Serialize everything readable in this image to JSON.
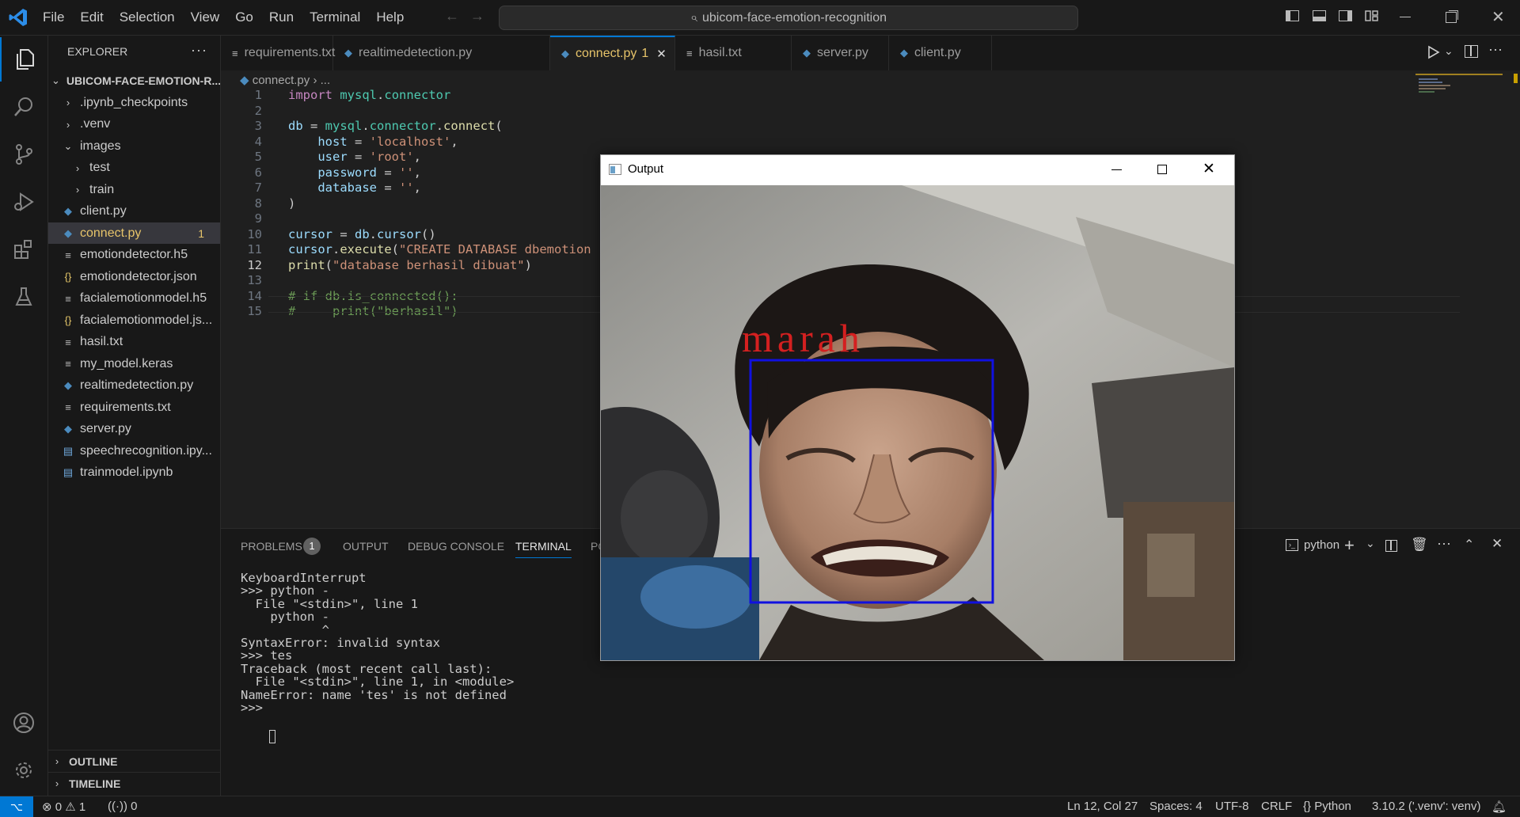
{
  "titlebar": {
    "menu": [
      "File",
      "Edit",
      "Selection",
      "View",
      "Go",
      "Run",
      "Terminal",
      "Help"
    ],
    "search": "ubicom-face-emotion-recognition"
  },
  "sidebar": {
    "header": "EXPLORER",
    "project": "UBICOM-FACE-EMOTION-R...",
    "items": [
      {
        "label": ".ipynb_checkpoints",
        "icon": "chevron-right-icon"
      },
      {
        "label": ".venv",
        "icon": "chevron-right-icon"
      },
      {
        "label": "images",
        "icon": "chevron-down-icon"
      },
      {
        "label": "test",
        "icon": "chevron-right-icon"
      },
      {
        "label": "train",
        "icon": "chevron-right-icon"
      },
      {
        "label": "client.py",
        "icon": "python-icon"
      },
      {
        "label": "connect.py",
        "icon": "python-icon",
        "badge": "1"
      },
      {
        "label": "emotiondetector.h5",
        "icon": "file-lines-icon"
      },
      {
        "label": "emotiondetector.json",
        "icon": "json-icon"
      },
      {
        "label": "facialemotionmodel.h5",
        "icon": "file-lines-icon"
      },
      {
        "label": "facialemotionmodel.js...",
        "icon": "json-icon"
      },
      {
        "label": "hasil.txt",
        "icon": "file-lines-icon"
      },
      {
        "label": "my_model.keras",
        "icon": "file-lines-icon"
      },
      {
        "label": "realtimedetection.py",
        "icon": "python-icon"
      },
      {
        "label": "requirements.txt",
        "icon": "file-lines-icon"
      },
      {
        "label": "server.py",
        "icon": "python-icon"
      },
      {
        "label": "speechrecognition.ipy...",
        "icon": "notebook-icon"
      },
      {
        "label": "trainmodel.ipynb",
        "icon": "notebook-icon"
      }
    ],
    "outline": "OUTLINE",
    "timeline": "TIMELINE"
  },
  "tabs": [
    {
      "label": "requirements.txt",
      "icon": "file-lines-icon"
    },
    {
      "label": "realtimedetection.py",
      "icon": "python-icon"
    },
    {
      "label": "connect.py",
      "icon": "python-icon",
      "badge": "1",
      "active": true
    },
    {
      "label": "hasil.txt",
      "icon": "file-lines-icon"
    },
    {
      "label": "server.py",
      "icon": "python-icon"
    },
    {
      "label": "client.py",
      "icon": "python-icon"
    }
  ],
  "breadcrumb": {
    "file": "connect.py",
    "rest": "..."
  },
  "editor": {
    "lines": [
      {
        "n": "1",
        "code": "import mysql.connector"
      },
      {
        "n": "2",
        "code": ""
      },
      {
        "n": "3",
        "code": "db = mysql.connector.connect("
      },
      {
        "n": "4",
        "code": "    host = 'localhost',"
      },
      {
        "n": "5",
        "code": "    user = 'root',"
      },
      {
        "n": "6",
        "code": "    password = '',"
      },
      {
        "n": "7",
        "code": "    database = '',"
      },
      {
        "n": "8",
        "code": ")"
      },
      {
        "n": "9",
        "code": ""
      },
      {
        "n": "10",
        "code": "cursor = db.cursor()"
      },
      {
        "n": "11",
        "code": "cursor.execute(\"CREATE DATABASE dbemotion"
      },
      {
        "n": "12",
        "code": "print(\"database berhasil dibuat\")"
      },
      {
        "n": "13",
        "code": ""
      },
      {
        "n": "14",
        "code": "# if db.is_connected():"
      },
      {
        "n": "15",
        "code": "#     print(\"berhasil\")"
      }
    ]
  },
  "panel": {
    "tabs": [
      "PROBLEMS",
      "OUTPUT",
      "DEBUG CONSOLE",
      "TERMINAL",
      "PO"
    ],
    "problems_count": "1",
    "shell": "python",
    "terminal": [
      "KeyboardInterrupt",
      ">>> python -",
      "  File \"<stdin>\", line 1",
      "    python -",
      "           ^",
      "SyntaxError: invalid syntax",
      ">>> tes",
      "Traceback (most recent call last):",
      "  File \"<stdin>\", line 1, in <module>",
      "NameError: name 'tes' is not defined",
      ">>> "
    ]
  },
  "output_window": {
    "title": "Output",
    "emotion_label": "marah"
  },
  "status": {
    "errors": "0",
    "warnings": "1",
    "ports": "0",
    "position": "Ln 12, Col 27",
    "spaces": "Spaces: 4",
    "encoding": "UTF-8",
    "eol": "CRLF",
    "language": "Python",
    "interpreter": "3.10.2 ('.venv': venv)"
  },
  "colors": {
    "accent": "#0078d4",
    "modified": "#e7c46a",
    "keyword": "#c586c0",
    "string": "#ce9178",
    "comment": "#6a9955",
    "variable": "#9cdcfe",
    "function": "#dcdcaa",
    "emotion_text": "#d42020",
    "face_box": "#1010e0"
  }
}
